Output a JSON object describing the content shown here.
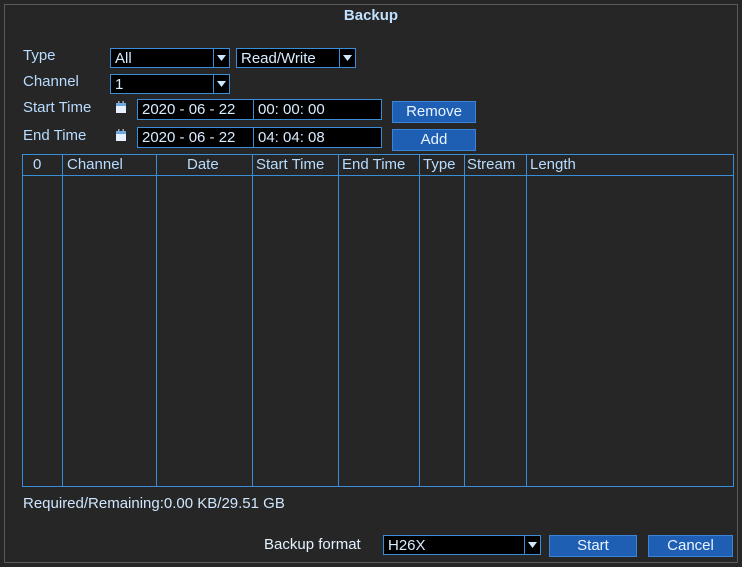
{
  "window": {
    "title": "Backup"
  },
  "filters": {
    "type_label": "Type",
    "type_value": "All",
    "mode_value": "Read/Write",
    "channel_label": "Channel",
    "channel_value": "1",
    "start_label": "Start Time",
    "start_date": "2020 - 06 - 22",
    "start_time": "00: 00: 00",
    "end_label": "End Time",
    "end_date": "2020 - 06 - 22",
    "end_time": "04: 04: 08",
    "remove_label": "Remove",
    "add_label": "Add"
  },
  "table": {
    "columns": [
      "0",
      "Channel",
      "Date",
      "Start Time",
      "End Time",
      "Type",
      "Stream",
      "Length"
    ],
    "rows": []
  },
  "status": {
    "text": "Required/Remaining:0.00 KB/29.51 GB"
  },
  "footer": {
    "format_label": "Backup format",
    "format_value": "H26X",
    "start_label": "Start",
    "cancel_label": "Cancel"
  },
  "colors": {
    "accent": "#3a8ed8",
    "button": "#1e5fb4",
    "background": "#262626",
    "label": "#b8dcff"
  }
}
